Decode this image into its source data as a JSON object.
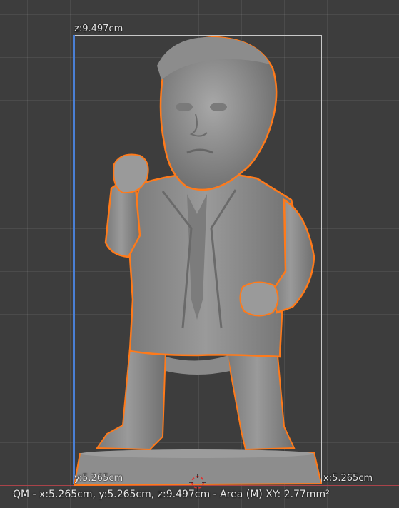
{
  "viewport": {
    "name": "3D viewport",
    "colors": {
      "background": "#3d3d3d",
      "grid": "#4a4a4a",
      "z_axis": "#4a7fd4",
      "x_axis": "#b5424a",
      "selection_outline": "#ff7a1a",
      "bbox": "#c8c8c8"
    }
  },
  "dimensions": {
    "z_label": "z:9.497cm",
    "y_label": "y:5.265cm",
    "x_label": "x:5.265cm"
  },
  "status_bar": {
    "text": "QM - x:5.265cm, y:5.265cm, z:9.497cm - Area (M) XY: 2.77mm²"
  },
  "icons": {
    "cursor": "3d-cursor-icon"
  }
}
